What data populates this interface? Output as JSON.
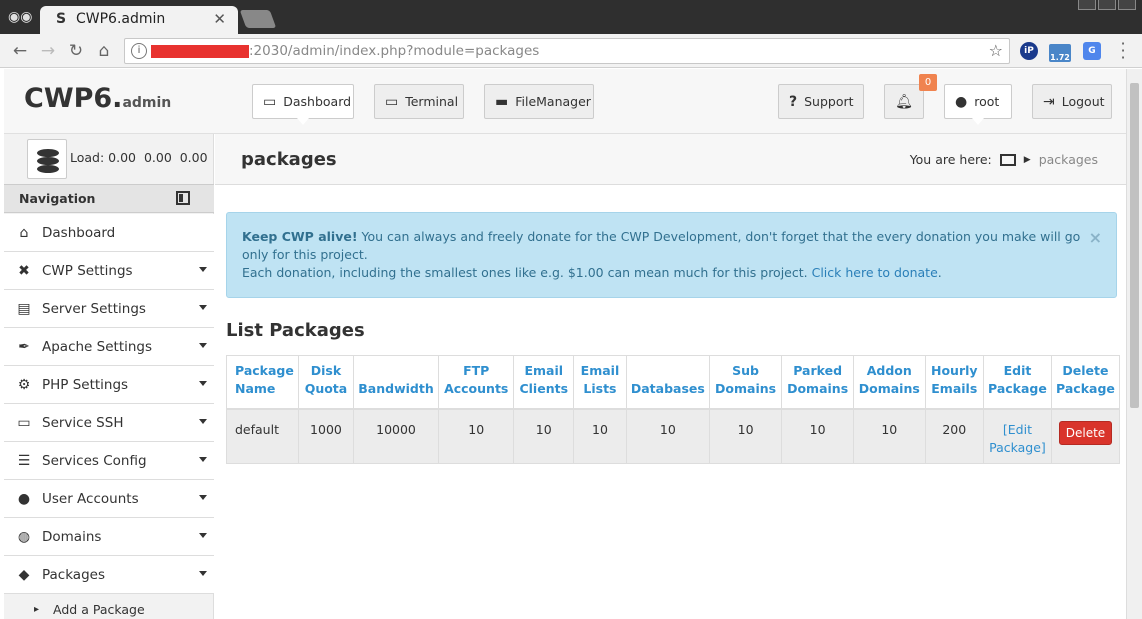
{
  "browser": {
    "tab_title": "CWP6.admin",
    "tab_favicon": "S",
    "url": ":2030/admin/index.php?module=packages",
    "ext_badge": "1.72"
  },
  "header": {
    "logo_main": "CWP6.",
    "logo_sub": "admin",
    "buttons": {
      "dashboard": "Dashboard",
      "terminal": "Terminal",
      "filemanager": "FileManager",
      "support": "Support",
      "notifications_count": "0",
      "user": "root",
      "logout": "Logout"
    }
  },
  "sidebar": {
    "load": "Load: 0.00  0.00  0.00",
    "nav_title": "Navigation",
    "items": [
      {
        "label": "Dashboard",
        "icon": "home-icon"
      },
      {
        "label": "CWP Settings",
        "icon": "tools-icon"
      },
      {
        "label": "Server Settings",
        "icon": "server-icon"
      },
      {
        "label": "Apache Settings",
        "icon": "feather-icon"
      },
      {
        "label": "PHP Settings",
        "icon": "gear-icon"
      },
      {
        "label": "Service SSH",
        "icon": "monitor-icon"
      },
      {
        "label": "Services Config",
        "icon": "list-icon"
      },
      {
        "label": "User Accounts",
        "icon": "user-icon"
      },
      {
        "label": "Domains",
        "icon": "globe-icon"
      },
      {
        "label": "Packages",
        "icon": "box-icon"
      }
    ],
    "subitems": [
      "Add a Package"
    ]
  },
  "page": {
    "title": "packages",
    "crumb_prefix": "You are here:",
    "crumb_current": "packages"
  },
  "alert": {
    "bold": "Keep CWP alive!",
    "text1": " You can always and freely donate for the CWP Development, don't forget that the every donation you make will go only for this project.",
    "text2": "Each donation, including the smallest ones like e.g. $1.00 can mean much for this project. ",
    "link": "Click here to donate",
    "tail": "."
  },
  "packages": {
    "title": "List Packages",
    "headers": [
      [
        "Package",
        "Name"
      ],
      [
        "Disk",
        "Quota"
      ],
      [
        "",
        "Bandwidth"
      ],
      [
        "FTP",
        "Accounts"
      ],
      [
        "Email",
        "Clients"
      ],
      [
        "Email",
        "Lists"
      ],
      [
        "",
        "Databases"
      ],
      [
        "Sub",
        "Domains"
      ],
      [
        "Parked",
        "Domains"
      ],
      [
        "Addon",
        "Domains"
      ],
      [
        "Hourly",
        "Emails"
      ],
      [
        "Edit",
        "Package"
      ],
      [
        "Delete",
        "Package"
      ]
    ],
    "rows": [
      {
        "name": "default",
        "disk": "1000",
        "bandwidth": "10000",
        "ftp": "10",
        "email_clients": "10",
        "email_lists": "10",
        "databases": "10",
        "sub_domains": "10",
        "parked_domains": "10",
        "addon_domains": "10",
        "hourly_emails": "200",
        "edit_l1": "[Edit",
        "edit_l2": "Package]",
        "delete": "Delete"
      }
    ]
  },
  "colors": {
    "link": "#2f8fcf",
    "delete": "#d9342b",
    "alert_bg": "#bfe3f3",
    "badge": "#f0834f"
  }
}
